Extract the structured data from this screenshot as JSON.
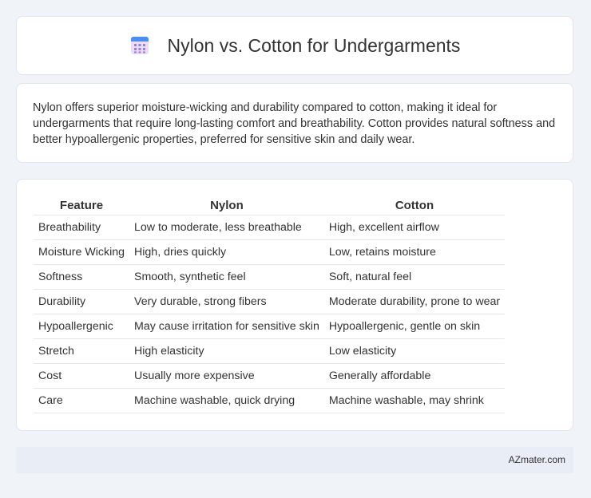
{
  "header": {
    "title": "Nylon vs. Cotton for Undergarments",
    "icon": "table-icon"
  },
  "summary": "Nylon offers superior moisture-wicking and durability compared to cotton, making it ideal for undergarments that require long-lasting comfort and breathability. Cotton provides natural softness and better hypoallergenic properties, preferred for sensitive skin and daily wear.",
  "table": {
    "headers": [
      "Feature",
      "Nylon",
      "Cotton"
    ],
    "rows": [
      [
        "Breathability",
        "Low to moderate, less breathable",
        "High, excellent airflow"
      ],
      [
        "Moisture Wicking",
        "High, dries quickly",
        "Low, retains moisture"
      ],
      [
        "Softness",
        "Smooth, synthetic feel",
        "Soft, natural feel"
      ],
      [
        "Durability",
        "Very durable, strong fibers",
        "Moderate durability, prone to wear"
      ],
      [
        "Hypoallergenic",
        "May cause irritation for sensitive skin",
        "Hypoallergenic, gentle on skin"
      ],
      [
        "Stretch",
        "High elasticity",
        "Low elasticity"
      ],
      [
        "Cost",
        "Usually more expensive",
        "Generally affordable"
      ],
      [
        "Care",
        "Machine washable, quick drying",
        "Machine washable, may shrink"
      ]
    ]
  },
  "footer": {
    "text": "AZmater.com"
  }
}
